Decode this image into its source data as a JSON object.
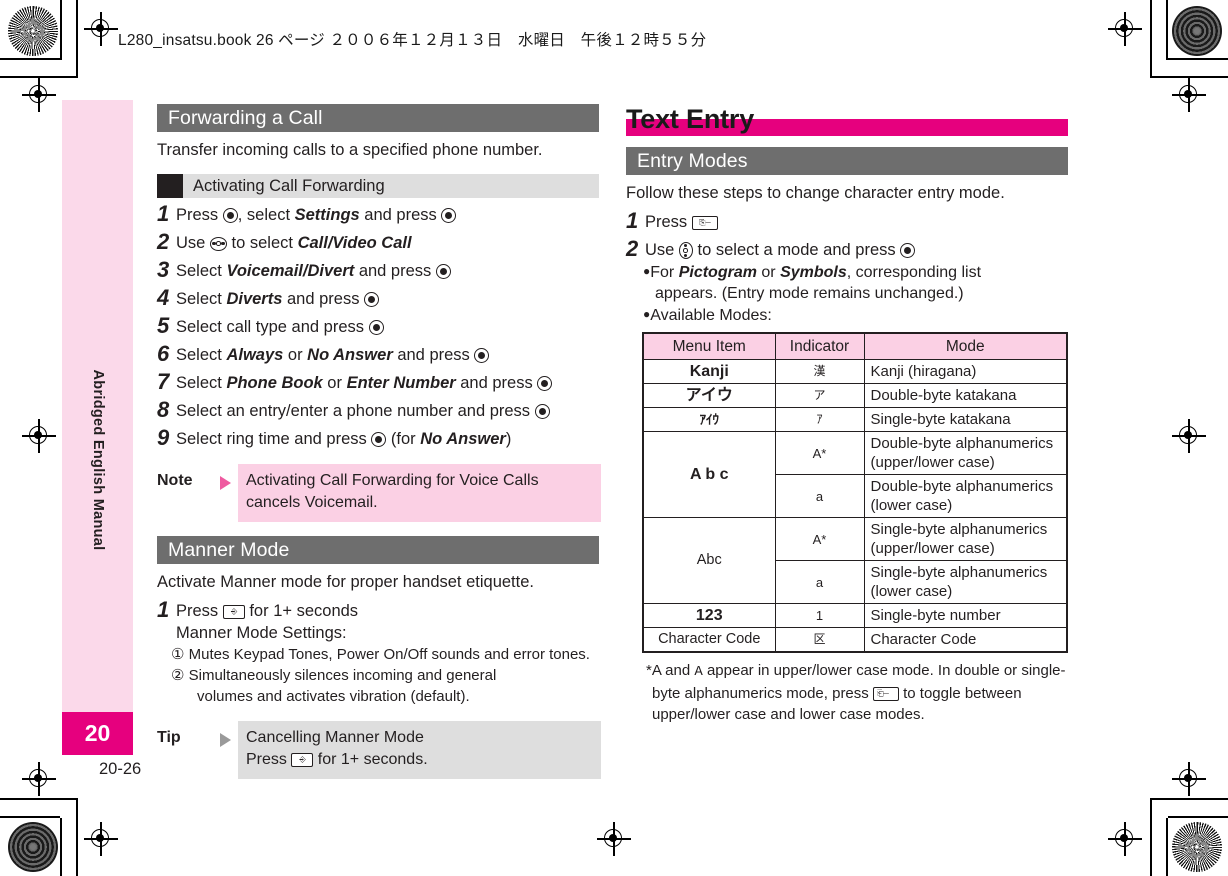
{
  "running_head": "L280_insatsu.book  26 ページ  ２００６年１２月１３日　水曜日　午後１２時５５分",
  "sidebar": {
    "label": "Abridged English Manual",
    "chapter": "20",
    "folio": "20-26"
  },
  "colors": {
    "magenta": "#e6007e",
    "pink_tab": "#fbd9ea",
    "pink_note": "#fbd0e4",
    "gray_header": "#6e6e6e",
    "gray_sub": "#dedede"
  },
  "left_column": {
    "section_title": "Forwarding a Call",
    "intro": "Transfer incoming calls to a specified phone number.",
    "subsection": "Activating Call Forwarding",
    "steps": [
      {
        "num": "1",
        "pre": "Press ",
        "mid": ", select ",
        "em1": "Settings",
        "post": " and press ",
        "keys": [
          "center",
          "center"
        ]
      },
      {
        "num": "2",
        "text_a": "Use ",
        "text_b": " to select ",
        "em1": "Call/Video Call"
      },
      {
        "num": "3",
        "text_a": "Select ",
        "em1": "Voicemail/Divert",
        "text_b": " and press "
      },
      {
        "num": "4",
        "text_a": "Select ",
        "em1": "Diverts",
        "text_b": " and press "
      },
      {
        "num": "5",
        "text_a": "Select call type and press "
      },
      {
        "num": "6",
        "text_a": "Select ",
        "em1": "Always",
        "text_b": " or ",
        "em2": "No Answer",
        "text_c": " and press "
      },
      {
        "num": "7",
        "text_a": "Select ",
        "em1": "Phone Book",
        "text_b": " or ",
        "em2": "Enter Number",
        "text_c": " and press "
      },
      {
        "num": "8",
        "text_a": "Select an entry/enter a phone number and press "
      },
      {
        "num": "9",
        "text_a": "Select ring time and press ",
        "text_b": " (for ",
        "em1": "No Answer",
        "text_c": ")"
      }
    ],
    "note": {
      "tag": "Note",
      "text": "Activating Call Forwarding for Voice Calls cancels Voicemail."
    },
    "manner": {
      "section_title": "Manner Mode",
      "intro": "Activate Manner mode for proper handset etiquette.",
      "step_num": "1",
      "step_a": "Press ",
      "step_b": " for 1+ seconds",
      "settings_label": "Manner Mode Settings:",
      "items": [
        {
          "mark": "①",
          "text": "Mutes Keypad Tones, Power On/Off sounds and error tones."
        },
        {
          "mark": "②",
          "text": "Simultaneously silences incoming and general",
          "cont": "volumes and activates vibration (default)."
        }
      ],
      "tip": {
        "tag": "Tip",
        "title": "Cancelling Manner Mode",
        "line_a": "Press ",
        "line_b": " for 1+ seconds."
      }
    }
  },
  "right_column": {
    "chapter_title": "Text Entry",
    "section_title": "Entry Modes",
    "intro": "Follow these steps to change character entry mode.",
    "steps": [
      {
        "num": "1",
        "text_a": "Press "
      },
      {
        "num": "2",
        "text_a": "Use ",
        "text_b": " to select a mode and press "
      }
    ],
    "bullets": [
      {
        "pre": "For ",
        "em1": "Pictogram",
        "mid": " or ",
        "em2": "Symbols",
        "post": ", corresponding list",
        "cont": "appears. (Entry mode remains unchanged.)"
      },
      {
        "pre": "Available Modes:"
      }
    ],
    "table": {
      "headers": [
        "Menu Item",
        "Indicator",
        "Mode"
      ],
      "rows": [
        {
          "menu": "Kanji",
          "menu_style": "bold",
          "rowspan": 1,
          "cells": [
            {
              "indicator": "漢",
              "indicator_jp": true,
              "mode": "Kanji (hiragana)"
            }
          ]
        },
        {
          "menu": "アイウ",
          "menu_style": "bold",
          "rowspan": 1,
          "cells": [
            {
              "indicator": "ア",
              "indicator_jp": true,
              "mode": "Double-byte katakana"
            }
          ]
        },
        {
          "menu": "ｱｲｳ",
          "menu_style": "small",
          "rowspan": 1,
          "cells": [
            {
              "indicator": "ｱ",
              "indicator_jp": true,
              "mode": "Single-byte katakana"
            }
          ]
        },
        {
          "menu": "A b c",
          "menu_style": "bold",
          "rowspan": 2,
          "cells": [
            {
              "indicator": "A*",
              "mode": "Double-byte alphanumerics (upper/lower case)"
            },
            {
              "indicator": "a",
              "mode": "Double-byte alphanumerics (lower case)"
            }
          ]
        },
        {
          "menu": "Abc",
          "menu_style": "plain",
          "rowspan": 2,
          "cells": [
            {
              "indicator": "A*",
              "mode": "Single-byte alphanumerics (upper/lower case)"
            },
            {
              "indicator": "a",
              "mode": "Single-byte alphanumerics (lower case)"
            }
          ]
        },
        {
          "menu": "123",
          "menu_style": "bold",
          "rowspan": 1,
          "cells": [
            {
              "indicator": "1",
              "mode": "Single-byte number"
            }
          ]
        },
        {
          "menu": "Character Code",
          "menu_style": "plain",
          "rowspan": 1,
          "cells": [
            {
              "indicator": "区",
              "indicator_jp": true,
              "mode": "Character Code"
            }
          ]
        }
      ]
    },
    "footnote": {
      "part_a": "*A and ",
      "mono": "A",
      "part_b": " appear in upper/lower case mode. In double or single-byte alphanumerics mode, press ",
      "part_c": " to toggle between upper/lower case and lower case modes."
    }
  }
}
